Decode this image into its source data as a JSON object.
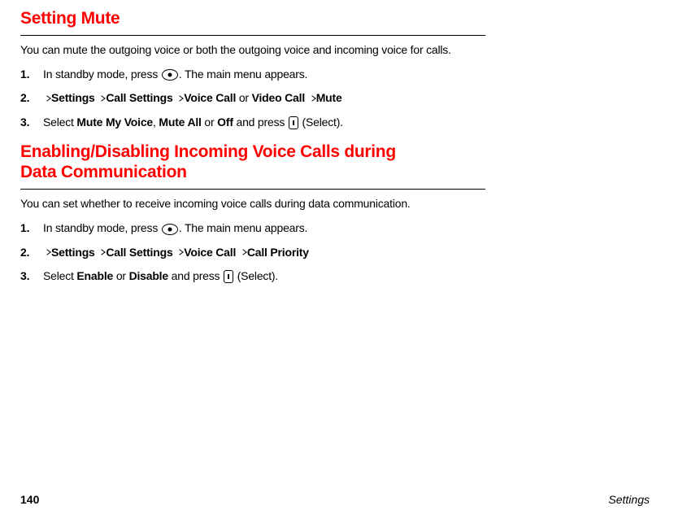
{
  "section1": {
    "heading": "Setting Mute",
    "intro": "You can mute the outgoing voice or both the outgoing voice and incoming voice for calls.",
    "steps": {
      "s1_num": "1.",
      "s1_a": "In standby mode, press ",
      "s1_b": ". The main menu appears.",
      "s2_num": "2.",
      "s2_settings": "Settings",
      "s2_callsettings": "Call Settings",
      "s2_voicecall": "Voice Call",
      "s2_or": " or ",
      "s2_videocall": "Video Call",
      "s2_mute": "Mute",
      "s3_num": "3.",
      "s3_a": "Select ",
      "s3_mutemyvoice": "Mute My Voice",
      "s3_comma": ", ",
      "s3_muteall": "Mute All",
      "s3_or": " or ",
      "s3_off": "Off",
      "s3_b": " and press ",
      "s3_c": " (Select)."
    }
  },
  "section2": {
    "heading1": "Enabling/Disabling Incoming Voice Calls during",
    "heading2": "Data Communication",
    "intro": "You can set whether to receive incoming voice calls during data communication.",
    "steps": {
      "s1_num": "1.",
      "s1_a": "In standby mode, press ",
      "s1_b": ". The main menu appears.",
      "s2_num": "2.",
      "s2_settings": "Settings",
      "s2_callsettings": "Call Settings",
      "s2_voicecall": "Voice Call",
      "s2_callpriority": "Call Priority",
      "s3_num": "3.",
      "s3_a": "Select ",
      "s3_enable": "Enable",
      "s3_or": " or ",
      "s3_disable": "Disable",
      "s3_b": " and press ",
      "s3_c": " (Select)."
    }
  },
  "footer": {
    "page": "140",
    "label": "Settings"
  }
}
